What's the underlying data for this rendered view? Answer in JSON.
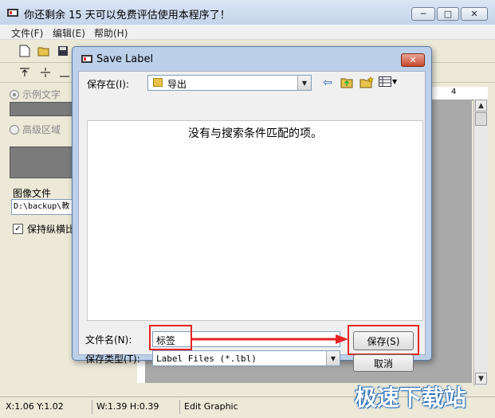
{
  "app": {
    "title": "你还剩余 15 天可以免费评估使用本程序了！",
    "window_buttons": {
      "minimize": "─",
      "maximize": "□",
      "close": "✕"
    }
  },
  "menu": [
    "文件(F)",
    "编辑(E)",
    "帮助(H)"
  ],
  "left_panel": {
    "radio_sample_text": "示例文字",
    "radio_advanced_area": "高级区域",
    "image_file_label": "图像文件",
    "image_file_path": "D:\\backup\\教",
    "keep_ratio_label": "保持纵横比"
  },
  "ruler": {
    "mark": "4"
  },
  "status": {
    "xy": "X:1.06  Y:1.02",
    "wh": "W:1.39  H:0.39",
    "mode": "Edit Graphic"
  },
  "watermark": "极速下载站",
  "dialog": {
    "title": "Save Label",
    "close_label": "✕",
    "save_in_label": "保存在(I):",
    "save_in_value": "导出",
    "empty_message": "没有与搜索条件匹配的项。",
    "filename_label": "文件名(N):",
    "filename_value": "标签",
    "filetype_label": "保存类型(T):",
    "filetype_value": "Label Files (*.lbl)",
    "save_button": "保存(S)",
    "cancel_button": "取消"
  },
  "colors": {
    "highlight_red": "#e52424",
    "folder_yellow": "#e8c34a"
  }
}
